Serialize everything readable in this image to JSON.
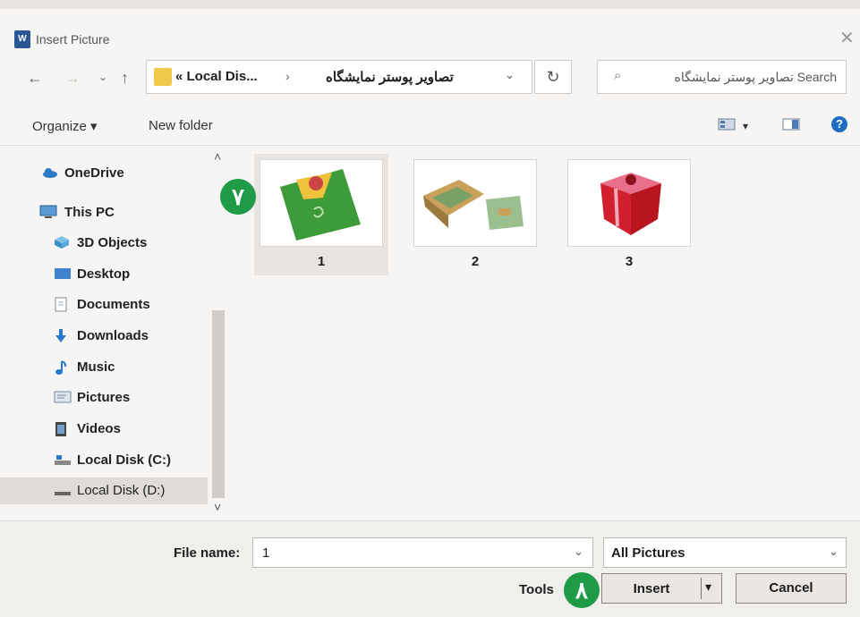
{
  "window": {
    "title": "Insert Picture",
    "close_glyph": "✕"
  },
  "nav": {
    "back": "←",
    "forward": "→",
    "recent": "⌄",
    "up": "↑",
    "address": {
      "prefix": "« Local Dis...",
      "separator": "›",
      "current": "تصاویر پوستر نمایشگاه",
      "dropdown": "⌄"
    },
    "refresh": "↻",
    "search_placeholder": "Search تصاویر پوستر نمایشگاه",
    "search_icon": "⌕"
  },
  "toolbar": {
    "organize": "Organize ▾",
    "new_folder": "New folder",
    "view_menu_arrow": "▾",
    "help": "?"
  },
  "sidebar": {
    "items": [
      {
        "label": "OneDrive",
        "icon": "cloud-icon"
      },
      {
        "label": "This PC",
        "icon": "computer-icon"
      },
      {
        "label": "3D Objects",
        "icon": "cube-icon"
      },
      {
        "label": "Desktop",
        "icon": "desktop-icon"
      },
      {
        "label": "Documents",
        "icon": "document-icon"
      },
      {
        "label": "Downloads",
        "icon": "download-icon"
      },
      {
        "label": "Music",
        "icon": "music-icon"
      },
      {
        "label": "Pictures",
        "icon": "pictures-icon"
      },
      {
        "label": "Videos",
        "icon": "video-icon"
      },
      {
        "label": "Local Disk (C:)",
        "icon": "drive-icon"
      },
      {
        "label": "Local Disk (D:)",
        "icon": "drive-icon"
      }
    ],
    "selected_index": 10,
    "scroll_up": "˄",
    "scroll_down": "˅"
  },
  "files": [
    {
      "name": "1",
      "selected": true
    },
    {
      "name": "2",
      "selected": false
    },
    {
      "name": "3",
      "selected": false
    }
  ],
  "footer": {
    "file_name_label": "File name:",
    "file_name_value": "1",
    "dropdown": "⌄",
    "file_type": "All Pictures",
    "tools": "Tools",
    "insert": "Insert",
    "insert_arrow": "▾",
    "cancel": "Cancel"
  },
  "badges": {
    "step7": "۷",
    "step8": "۸"
  },
  "colors": {
    "badge": "#1f9a47",
    "selected": "#e6e3e0",
    "accent": "#1f6cc2"
  }
}
